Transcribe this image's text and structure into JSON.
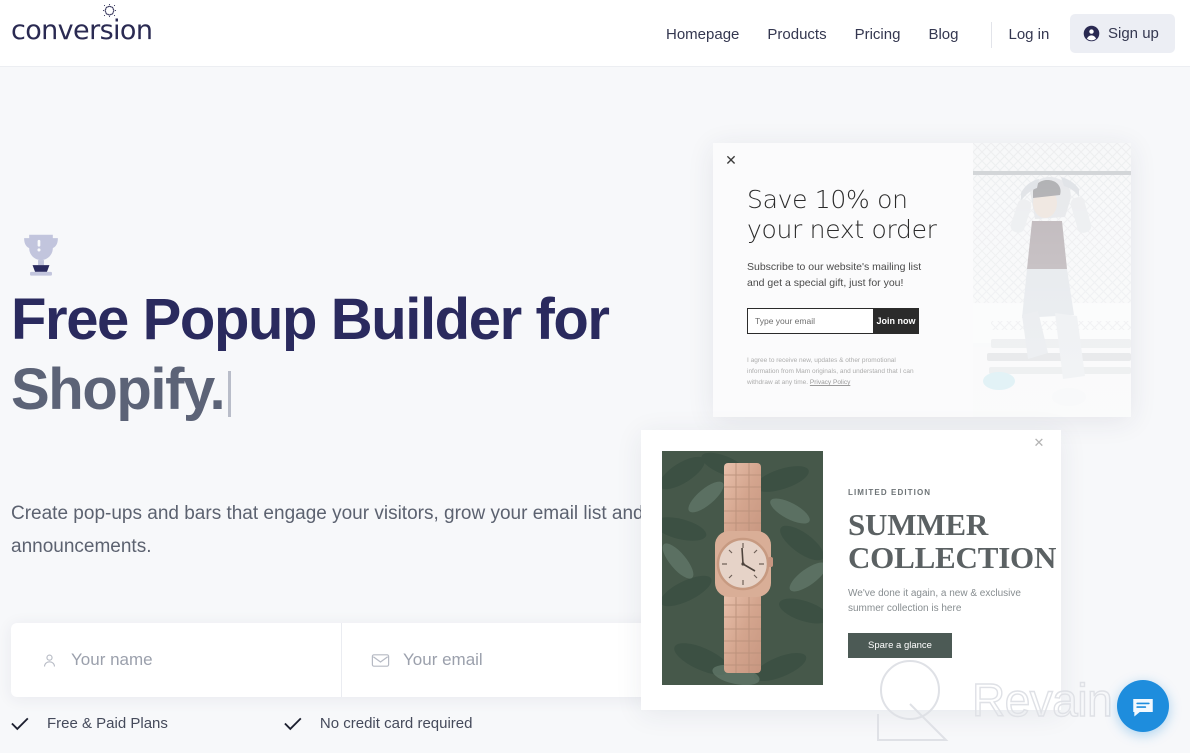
{
  "brand": {
    "name": "conversion",
    "gear_icon": "gear-flower-icon"
  },
  "nav": {
    "links": [
      {
        "label": "Homepage"
      },
      {
        "label": "Products"
      },
      {
        "label": "Pricing"
      },
      {
        "label": "Blog"
      }
    ],
    "login_label": "Log in",
    "signup_label": "Sign up",
    "signup_icon": "user-circle-icon"
  },
  "hero": {
    "badge_icon": "trophy-icon",
    "title_line1": "Free Popup Builder for",
    "title_line2": "Shopify.",
    "subtitle": "Create pop-ups and bars that engage your visitors, grow your email list and display announcements.",
    "form": {
      "name_placeholder": "Your name",
      "name_value": "",
      "name_icon": "user-icon",
      "email_placeholder": "Your email",
      "email_value": "",
      "email_icon": "envelope-icon"
    },
    "perks": [
      {
        "icon": "check-icon",
        "label": "Free & Paid Plans"
      },
      {
        "icon": "check-icon",
        "label": "No credit card required"
      }
    ]
  },
  "popup_preview_1": {
    "close_icon": "close-icon",
    "heading": "Save 10% on your next order",
    "subheading": "Subscribe to our website's mailing list and get a special gift, just for you!",
    "email_placeholder": "Type your email",
    "email_value": "",
    "submit_label": "Join now",
    "fine_print": "I agree to receive new, updates & other promotional information from Mam originals, and understand that I can withdraw at any time.",
    "privacy_label": "Privacy Policy",
    "image_alt": "young-man-sitting-on-bench",
    "accent_color": "#2b2b2b"
  },
  "popup_preview_2": {
    "close_icon": "close-icon",
    "kicker": "LIMITED EDITION",
    "title": "SUMMER COLLECTION",
    "subtitle": "We've done it again, a new & exclusive summer collection is here",
    "button_label": "Spare a glance",
    "image_alt": "rose-gold-watch-on-foliage",
    "accent_color": "#4c5a55"
  },
  "watermark": {
    "text": "Revain",
    "logo_icon": "revain-logo-icon"
  },
  "chat_widget": {
    "icon": "chat-message-icon",
    "color": "#1e8ddd"
  }
}
